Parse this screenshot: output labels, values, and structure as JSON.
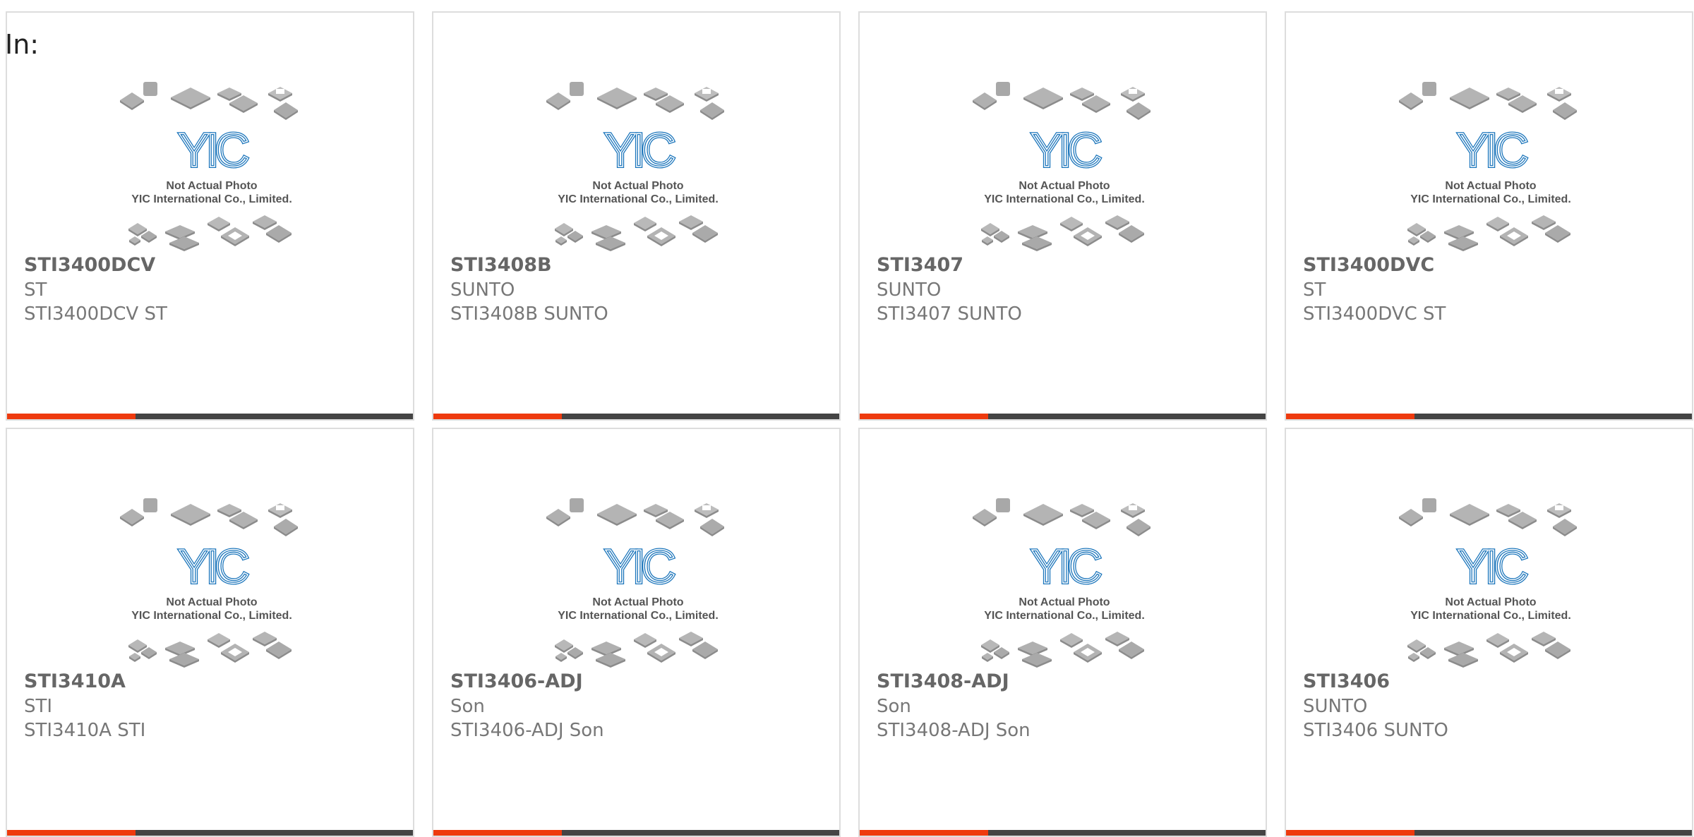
{
  "header": {
    "in_label": "In:"
  },
  "thumbnail": {
    "logo_text": "YIC",
    "caption_line1": "Not Actual Photo",
    "caption_line2": "YIC International Co., Limited.",
    "logo_color": "#1b75bb"
  },
  "colors": {
    "accent": "#ee3a0e",
    "bar": "#444444",
    "border": "#dddddd"
  },
  "products": [
    {
      "part": "STI3400DCV",
      "maker": "ST",
      "desc": "STI3400DCV ST"
    },
    {
      "part": "STI3408B",
      "maker": "SUNTO",
      "desc": "STI3408B SUNTO"
    },
    {
      "part": "STI3407",
      "maker": "SUNTO",
      "desc": "STI3407 SUNTO"
    },
    {
      "part": "STI3400DVC",
      "maker": "ST",
      "desc": "STI3400DVC ST"
    },
    {
      "part": "STI3410A",
      "maker": "STI",
      "desc": "STI3410A STI"
    },
    {
      "part": "STI3406-ADJ",
      "maker": "Son",
      "desc": "STI3406-ADJ Son"
    },
    {
      "part": "STI3408-ADJ",
      "maker": "Son",
      "desc": "STI3408-ADJ Son"
    },
    {
      "part": "STI3406",
      "maker": "SUNTO",
      "desc": "STI3406 SUNTO"
    }
  ]
}
